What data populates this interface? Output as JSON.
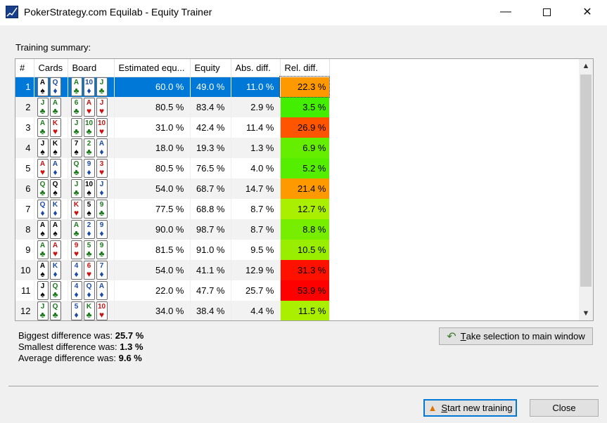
{
  "window": {
    "title": "PokerStrategy.com Equilab - Equity Trainer"
  },
  "summary_label": "Training summary:",
  "columns": [
    "#",
    "Cards",
    "Board",
    "Estimated equ...",
    "Equity",
    "Abs. diff.",
    "Rel. diff."
  ],
  "rows": [
    {
      "n": "1",
      "cards": [
        {
          "r": "A",
          "s": "♠"
        },
        {
          "r": "Q",
          "s": "♦"
        }
      ],
      "board": [
        {
          "r": "A",
          "s": "♣"
        },
        {
          "r": "10",
          "s": "♦"
        },
        {
          "r": "J",
          "s": "♣"
        }
      ],
      "est": "60.0 %",
      "eq": "49.0 %",
      "abs": "11.0 %",
      "rel": "22.3 %",
      "relColor": "#ff9900",
      "selected": true
    },
    {
      "n": "2",
      "cards": [
        {
          "r": "J",
          "s": "♣"
        },
        {
          "r": "A",
          "s": "♣"
        }
      ],
      "board": [
        {
          "r": "6",
          "s": "♣"
        },
        {
          "r": "A",
          "s": "♥"
        },
        {
          "r": "J",
          "s": "♥"
        }
      ],
      "est": "80.5 %",
      "eq": "83.4 %",
      "abs": "2.9 %",
      "rel": "3.5 %",
      "relColor": "#44ee00"
    },
    {
      "n": "3",
      "cards": [
        {
          "r": "A",
          "s": "♣"
        },
        {
          "r": "K",
          "s": "♥"
        }
      ],
      "board": [
        {
          "r": "J",
          "s": "♣"
        },
        {
          "r": "10",
          "s": "♣"
        },
        {
          "r": "10",
          "s": "♥"
        }
      ],
      "est": "31.0 %",
      "eq": "42.4 %",
      "abs": "11.4 %",
      "rel": "26.9 %",
      "relColor": "#ff5500"
    },
    {
      "n": "4",
      "cards": [
        {
          "r": "J",
          "s": "♠"
        },
        {
          "r": "K",
          "s": "♠"
        }
      ],
      "board": [
        {
          "r": "7",
          "s": "♠"
        },
        {
          "r": "2",
          "s": "♣"
        },
        {
          "r": "A",
          "s": "♦"
        }
      ],
      "est": "18.0 %",
      "eq": "19.3 %",
      "abs": "1.3 %",
      "rel": "6.9 %",
      "relColor": "#66ee00"
    },
    {
      "n": "5",
      "cards": [
        {
          "r": "A",
          "s": "♥"
        },
        {
          "r": "A",
          "s": "♦"
        }
      ],
      "board": [
        {
          "r": "Q",
          "s": "♣"
        },
        {
          "r": "9",
          "s": "♦"
        },
        {
          "r": "3",
          "s": "♥"
        }
      ],
      "est": "80.5 %",
      "eq": "76.5 %",
      "abs": "4.0 %",
      "rel": "5.2 %",
      "relColor": "#55ee00"
    },
    {
      "n": "6",
      "cards": [
        {
          "r": "Q",
          "s": "♣"
        },
        {
          "r": "Q",
          "s": "♠"
        }
      ],
      "board": [
        {
          "r": "J",
          "s": "♣"
        },
        {
          "r": "10",
          "s": "♠"
        },
        {
          "r": "J",
          "s": "♦"
        }
      ],
      "est": "54.0 %",
      "eq": "68.7 %",
      "abs": "14.7 %",
      "rel": "21.4 %",
      "relColor": "#ff9900"
    },
    {
      "n": "7",
      "cards": [
        {
          "r": "Q",
          "s": "♦"
        },
        {
          "r": "K",
          "s": "♦"
        }
      ],
      "board": [
        {
          "r": "K",
          "s": "♥"
        },
        {
          "r": "5",
          "s": "♠"
        },
        {
          "r": "9",
          "s": "♣"
        }
      ],
      "est": "77.5 %",
      "eq": "68.8 %",
      "abs": "8.7 %",
      "rel": "12.7 %",
      "relColor": "#aaee00"
    },
    {
      "n": "8",
      "cards": [
        {
          "r": "A",
          "s": "♠"
        },
        {
          "r": "A",
          "s": "♠"
        }
      ],
      "board": [
        {
          "r": "A",
          "s": "♣"
        },
        {
          "r": "2",
          "s": "♦"
        },
        {
          "r": "9",
          "s": "♦"
        }
      ],
      "est": "90.0 %",
      "eq": "98.7 %",
      "abs": "8.7 %",
      "rel": "8.8 %",
      "relColor": "#77ee00"
    },
    {
      "n": "9",
      "cards": [
        {
          "r": "A",
          "s": "♣"
        },
        {
          "r": "A",
          "s": "♥"
        }
      ],
      "board": [
        {
          "r": "9",
          "s": "♥"
        },
        {
          "r": "5",
          "s": "♣"
        },
        {
          "r": "9",
          "s": "♣"
        }
      ],
      "est": "81.5 %",
      "eq": "91.0 %",
      "abs": "9.5 %",
      "rel": "10.5 %",
      "relColor": "#99ee00"
    },
    {
      "n": "10",
      "cards": [
        {
          "r": "A",
          "s": "♠"
        },
        {
          "r": "K",
          "s": "♦"
        }
      ],
      "board": [
        {
          "r": "4",
          "s": "♦"
        },
        {
          "r": "6",
          "s": "♥"
        },
        {
          "r": "7",
          "s": "♦"
        }
      ],
      "est": "54.0 %",
      "eq": "41.1 %",
      "abs": "12.9 %",
      "rel": "31.3 %",
      "relColor": "#ff1100"
    },
    {
      "n": "11",
      "cards": [
        {
          "r": "J",
          "s": "♠"
        },
        {
          "r": "Q",
          "s": "♣"
        }
      ],
      "board": [
        {
          "r": "4",
          "s": "♦"
        },
        {
          "r": "Q",
          "s": "♦"
        },
        {
          "r": "A",
          "s": "♦"
        }
      ],
      "est": "22.0 %",
      "eq": "47.7 %",
      "abs": "25.7 %",
      "rel": "53.9 %",
      "relColor": "#ff0000"
    },
    {
      "n": "12",
      "cards": [
        {
          "r": "J",
          "s": "♣"
        },
        {
          "r": "Q",
          "s": "♣"
        }
      ],
      "board": [
        {
          "r": "5",
          "s": "♦"
        },
        {
          "r": "K",
          "s": "♣"
        },
        {
          "r": "10",
          "s": "♥"
        }
      ],
      "est": "34.0 %",
      "eq": "38.4 %",
      "abs": "4.4 %",
      "rel": "11.5 %",
      "relColor": "#aaee00"
    }
  ],
  "stats": {
    "biggest_label": "Biggest difference was:",
    "biggest_value": "25.7 %",
    "smallest_label": "Smallest difference was:",
    "smallest_value": "1.3 %",
    "average_label": "Average difference was:",
    "average_value": "9.6 %"
  },
  "buttons": {
    "take_selection_first": "T",
    "take_selection_rest": "ake selection to main window",
    "start_training_first": "S",
    "start_training_rest": "tart new training",
    "close": "Close"
  },
  "suit_colors": {
    "♠": "#000000",
    "♣": "#1a7a1a",
    "♦": "#1a4aa8",
    "♥": "#cc1111"
  }
}
